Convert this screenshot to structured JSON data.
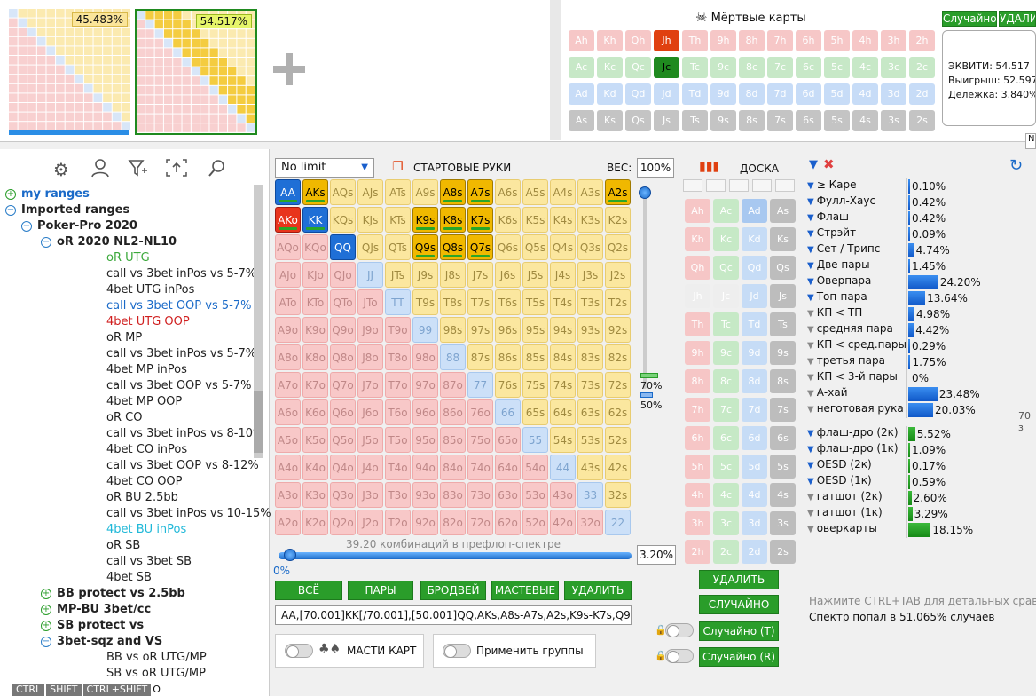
{
  "top": {
    "thumb1_pct": "45.483%",
    "thumb2_pct": "54.517%",
    "dead_cards_title": "Мёртвые карты",
    "random_btn": "Случайно",
    "delete_btn": "УДАЛИ",
    "dead_rows": [
      [
        "Ah",
        "Kh",
        "Qh",
        "Jh",
        "Th",
        "9h",
        "8h",
        "7h",
        "6h",
        "5h",
        "4h",
        "3h",
        "2h"
      ],
      [
        "Ac",
        "Kc",
        "Qc",
        "Jc",
        "Tc",
        "9c",
        "8c",
        "7c",
        "6c",
        "5c",
        "4c",
        "3c",
        "2c"
      ],
      [
        "Ad",
        "Kd",
        "Qd",
        "Jd",
        "Td",
        "9d",
        "8d",
        "7d",
        "6d",
        "5d",
        "4d",
        "3d",
        "2d"
      ],
      [
        "As",
        "Ks",
        "Qs",
        "Js",
        "Ts",
        "9s",
        "8s",
        "7s",
        "6s",
        "5s",
        "4s",
        "3s",
        "2s"
      ]
    ],
    "equity": "ЭКВИТИ: 54.517",
    "win": "Выигрыш: 52.597",
    "tie": "Делёжка: 3.840%",
    "n_letter": "N"
  },
  "tree": {
    "items": [
      {
        "label": "my ranges",
        "depth": 0,
        "exp": "+",
        "color": "#1a6ac8",
        "bold": true
      },
      {
        "label": "Imported ranges",
        "depth": 0,
        "exp": "−",
        "color": "#222",
        "bold": true
      },
      {
        "label": "Poker-Pro 2020",
        "depth": 1,
        "exp": "−",
        "color": "#222",
        "bold": true
      },
      {
        "label": "oR 2020 NL2-NL10",
        "depth": 2,
        "exp": "−",
        "color": "#222",
        "bold": true
      },
      {
        "label": "oR UTG",
        "depth": 3,
        "color": "#3aa83a"
      },
      {
        "label": "call vs 3bet inPos vs 5-7%",
        "depth": 3,
        "color": "#222"
      },
      {
        "label": "4bet UTG inPos",
        "depth": 3,
        "color": "#222"
      },
      {
        "label": "call  vs 3bet OOP vs 5-7%",
        "depth": 3,
        "color": "#1a6ac8"
      },
      {
        "label": "4bet UTG OOP",
        "depth": 3,
        "color": "#d02020"
      },
      {
        "label": "oR MP",
        "depth": 3,
        "color": "#222"
      },
      {
        "label": "call vs 3bet inPos vs 5-7%",
        "depth": 3,
        "color": "#222"
      },
      {
        "label": "4bet MP inPos",
        "depth": 3,
        "color": "#222"
      },
      {
        "label": "call vs 3bet OOP vs 5-7%",
        "depth": 3,
        "color": "#222"
      },
      {
        "label": "4bet MP OOP",
        "depth": 3,
        "color": "#222"
      },
      {
        "label": "oR CO",
        "depth": 3,
        "color": "#222"
      },
      {
        "label": "call vs 3bet inPos vs 8-10%",
        "depth": 3,
        "color": "#222"
      },
      {
        "label": "4bet CO inPos",
        "depth": 3,
        "color": "#222"
      },
      {
        "label": "call vs 3bet OOP vs 8-12%",
        "depth": 3,
        "color": "#222"
      },
      {
        "label": "4bet CO OOP",
        "depth": 3,
        "color": "#222"
      },
      {
        "label": "oR BU 2.5bb",
        "depth": 3,
        "color": "#222"
      },
      {
        "label": "call vs 3bet inPos vs 10-15%",
        "depth": 3,
        "color": "#222"
      },
      {
        "label": "4bet BU inPos",
        "depth": 3,
        "color": "#20b8d8"
      },
      {
        "label": "oR SB",
        "depth": 3,
        "color": "#222"
      },
      {
        "label": "call vs 3bet SB",
        "depth": 3,
        "color": "#222"
      },
      {
        "label": "4bet SB",
        "depth": 3,
        "color": "#222"
      },
      {
        "label": "BB protect vs 2.5bb",
        "depth": 2,
        "exp": "+",
        "color": "#222",
        "bold": true
      },
      {
        "label": "MP-BU 3bet/cc",
        "depth": 2,
        "exp": "+",
        "color": "#222",
        "bold": true
      },
      {
        "label": "SB protect vs",
        "depth": 2,
        "exp": "+",
        "color": "#222",
        "bold": true
      },
      {
        "label": "3bet-sqz and VS",
        "depth": 2,
        "exp": "−",
        "color": "#222",
        "bold": true
      },
      {
        "label": "BB vs oR UTG/MP",
        "depth": 3,
        "color": "#222"
      },
      {
        "label": "SB vs oR UTG/MP",
        "depth": 3,
        "color": "#222"
      }
    ],
    "keys": [
      "CTRL",
      "SHIFT",
      "CTRL+SHIFT"
    ],
    "key_tail": "O"
  },
  "range": {
    "mode": "No limit",
    "title": "СТАРТОВЫЕ РУКИ",
    "weight_label": "ВЕС:",
    "weight": "100%",
    "combos": "39.20 комбинаций в префлоп-спектре",
    "slider_min": "0%",
    "slider_value": "3.20%",
    "slider_fraction": 0.032,
    "weight_marks": [
      "70%",
      "50%"
    ],
    "btn_all": "ВСЁ",
    "btn_pairs": "ПАРЫ",
    "btn_broadway": "БРОДВЕЙ",
    "btn_suited": "МАСТЕВЫЕ",
    "btn_delete": "УДАЛИТЬ",
    "text": "AA,[70.001]KK[/70.001],[50.001]QQ,AKs,A8s-A7s,A2s,K9s-K7s,Q9",
    "suits_label": "МАСТИ КАРТ",
    "groups_label": "Применить группы",
    "ranks": [
      "A",
      "K",
      "Q",
      "J",
      "T",
      "9",
      "8",
      "7",
      "6",
      "5",
      "4",
      "3",
      "2"
    ],
    "selected": {
      "AA": "b",
      "KK": "b",
      "QQ": "b",
      "AKs": "y",
      "AKo": "r",
      "A8s": "y",
      "A7s": "y",
      "A2s": "y",
      "K9s": "y",
      "K8s": "y",
      "K7s": "y",
      "Q9s": "y",
      "Q8s": "y",
      "Q7s": "y"
    }
  },
  "board": {
    "title": "ДОСКА",
    "delete_btn": "УДАЛИТЬ",
    "random_btn": "СЛУЧАЙНО",
    "random_t": "Случайно (T)",
    "random_r": "Случайно (R)",
    "ranks": [
      "A",
      "K",
      "Q",
      "J",
      "T",
      "9",
      "8",
      "7",
      "6",
      "5",
      "4",
      "3",
      "2"
    ],
    "suits": [
      "h",
      "c",
      "d",
      "s"
    ]
  },
  "stats": {
    "rows": [
      {
        "label": "≥ Каре",
        "value": "0.10%",
        "frac": 0.001,
        "color": "blue",
        "icon": "blue"
      },
      {
        "label": "Фулл-Хаус",
        "value": "0.42%",
        "frac": 0.0042,
        "color": "blue",
        "icon": "blue"
      },
      {
        "label": "Флаш",
        "value": "0.42%",
        "frac": 0.0042,
        "color": "blue",
        "icon": "blue"
      },
      {
        "label": "Стрэйт",
        "value": "0.09%",
        "frac": 0.0009,
        "color": "blue",
        "icon": "blue"
      },
      {
        "label": "Сет / Трипс",
        "value": "4.74%",
        "frac": 0.0474,
        "color": "blue",
        "icon": "blue"
      },
      {
        "label": "Две пары",
        "value": "1.45%",
        "frac": 0.0145,
        "color": "blue",
        "icon": "blue"
      },
      {
        "label": "Оверпара",
        "value": "24.20%",
        "frac": 0.242,
        "color": "blue",
        "icon": "blue"
      },
      {
        "label": "Топ-пара",
        "value": "13.64%",
        "frac": 0.1364,
        "color": "blue",
        "icon": "blue"
      },
      {
        "label": "КП < ТП",
        "value": "4.98%",
        "frac": 0.0498,
        "color": "blue",
        "icon": "gray"
      },
      {
        "label": "средняя пара",
        "value": "4.42%",
        "frac": 0.0442,
        "color": "blue",
        "icon": "gray"
      },
      {
        "label": "КП < сред.пары",
        "value": "0.29%",
        "frac": 0.0029,
        "color": "blue",
        "icon": "gray"
      },
      {
        "label": "третья пара",
        "value": "1.75%",
        "frac": 0.0175,
        "color": "blue",
        "icon": "gray"
      },
      {
        "label": "КП < 3-й пары",
        "value": "0%",
        "frac": 0,
        "color": "blue",
        "icon": "gray"
      },
      {
        "label": "А-хай",
        "value": "23.48%",
        "frac": 0.2348,
        "color": "blue",
        "icon": "gray"
      },
      {
        "label": "неготовая рука",
        "value": "20.03%",
        "frac": 0.2003,
        "color": "blue",
        "icon": "gray"
      }
    ],
    "draws": [
      {
        "label": "флаш-дро (2к)",
        "value": "5.52%",
        "frac": 0.0552,
        "icon": "blue"
      },
      {
        "label": "флаш-дро (1к)",
        "value": "1.09%",
        "frac": 0.0109,
        "icon": "blue"
      },
      {
        "label": "OESD (2к)",
        "value": "0.17%",
        "frac": 0.0017,
        "icon": "blue"
      },
      {
        "label": "OESD (1к)",
        "value": "0.59%",
        "frac": 0.0059,
        "icon": "blue"
      },
      {
        "label": "гатшот (2к)",
        "value": "2.60%",
        "frac": 0.026,
        "icon": "gray"
      },
      {
        "label": "гатшот (1к)",
        "value": "3.29%",
        "frac": 0.0329,
        "icon": "gray"
      },
      {
        "label": "оверкарты",
        "value": "18.15%",
        "frac": 0.1815,
        "icon": "gray"
      }
    ],
    "hint": "Нажмите CTRL+TAB для детальных сравн",
    "hit": "Спектр попал в 51.065% случаев",
    "side_value": "70 з"
  }
}
